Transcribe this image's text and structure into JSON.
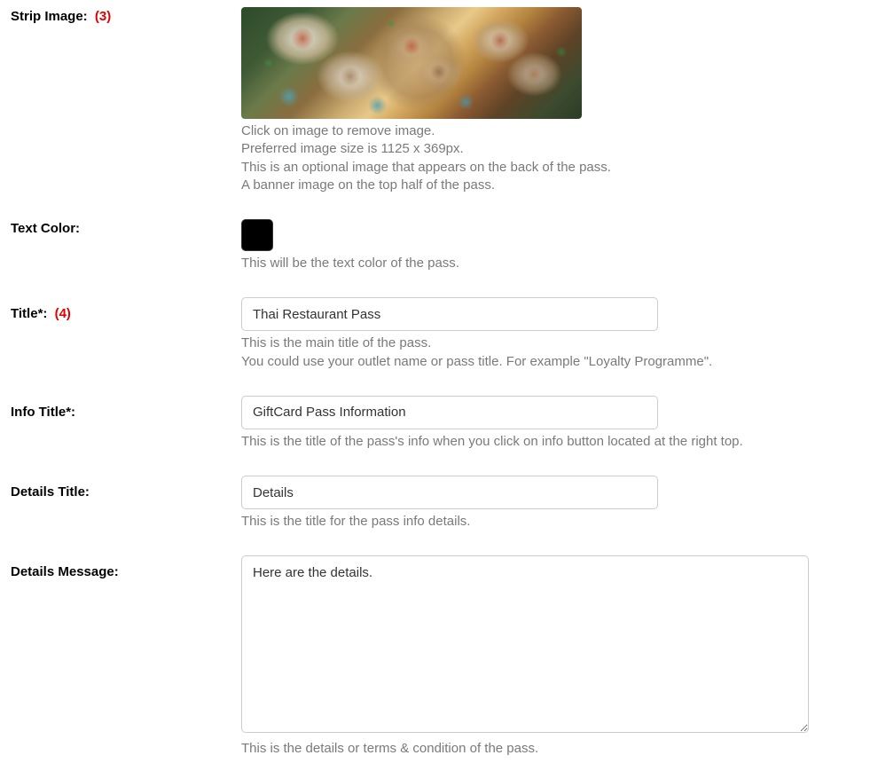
{
  "stripImage": {
    "label": "Strip Image:",
    "annotation": "(3)",
    "help1": "Click on image to remove image.",
    "help2": "Preferred image size is 1125 x 369px.",
    "help3": "This is an optional image that appears on the back of the pass.",
    "help4": "A banner image on the top half of the pass."
  },
  "textColor": {
    "label": "Text Color:",
    "value": "#000000",
    "help": "This will be the text color of the pass."
  },
  "title": {
    "label": "Title*:",
    "annotation": "(4)",
    "value": "Thai Restaurant Pass",
    "help1": "This is the main title of the pass.",
    "help2": "You could use your outlet name or pass title. For example \"Loyalty Programme\"."
  },
  "infoTitle": {
    "label": "Info Title*:",
    "value": "GiftCard Pass Information",
    "help": "This is the title of the pass's info when you click on info button located at the right top."
  },
  "detailsTitle": {
    "label": "Details Title:",
    "value": "Details",
    "help": "This is the title for the pass info details."
  },
  "detailsMessage": {
    "label": "Details Message:",
    "value": "Here are the details.",
    "help": "This is the details or terms & condition of the pass."
  }
}
